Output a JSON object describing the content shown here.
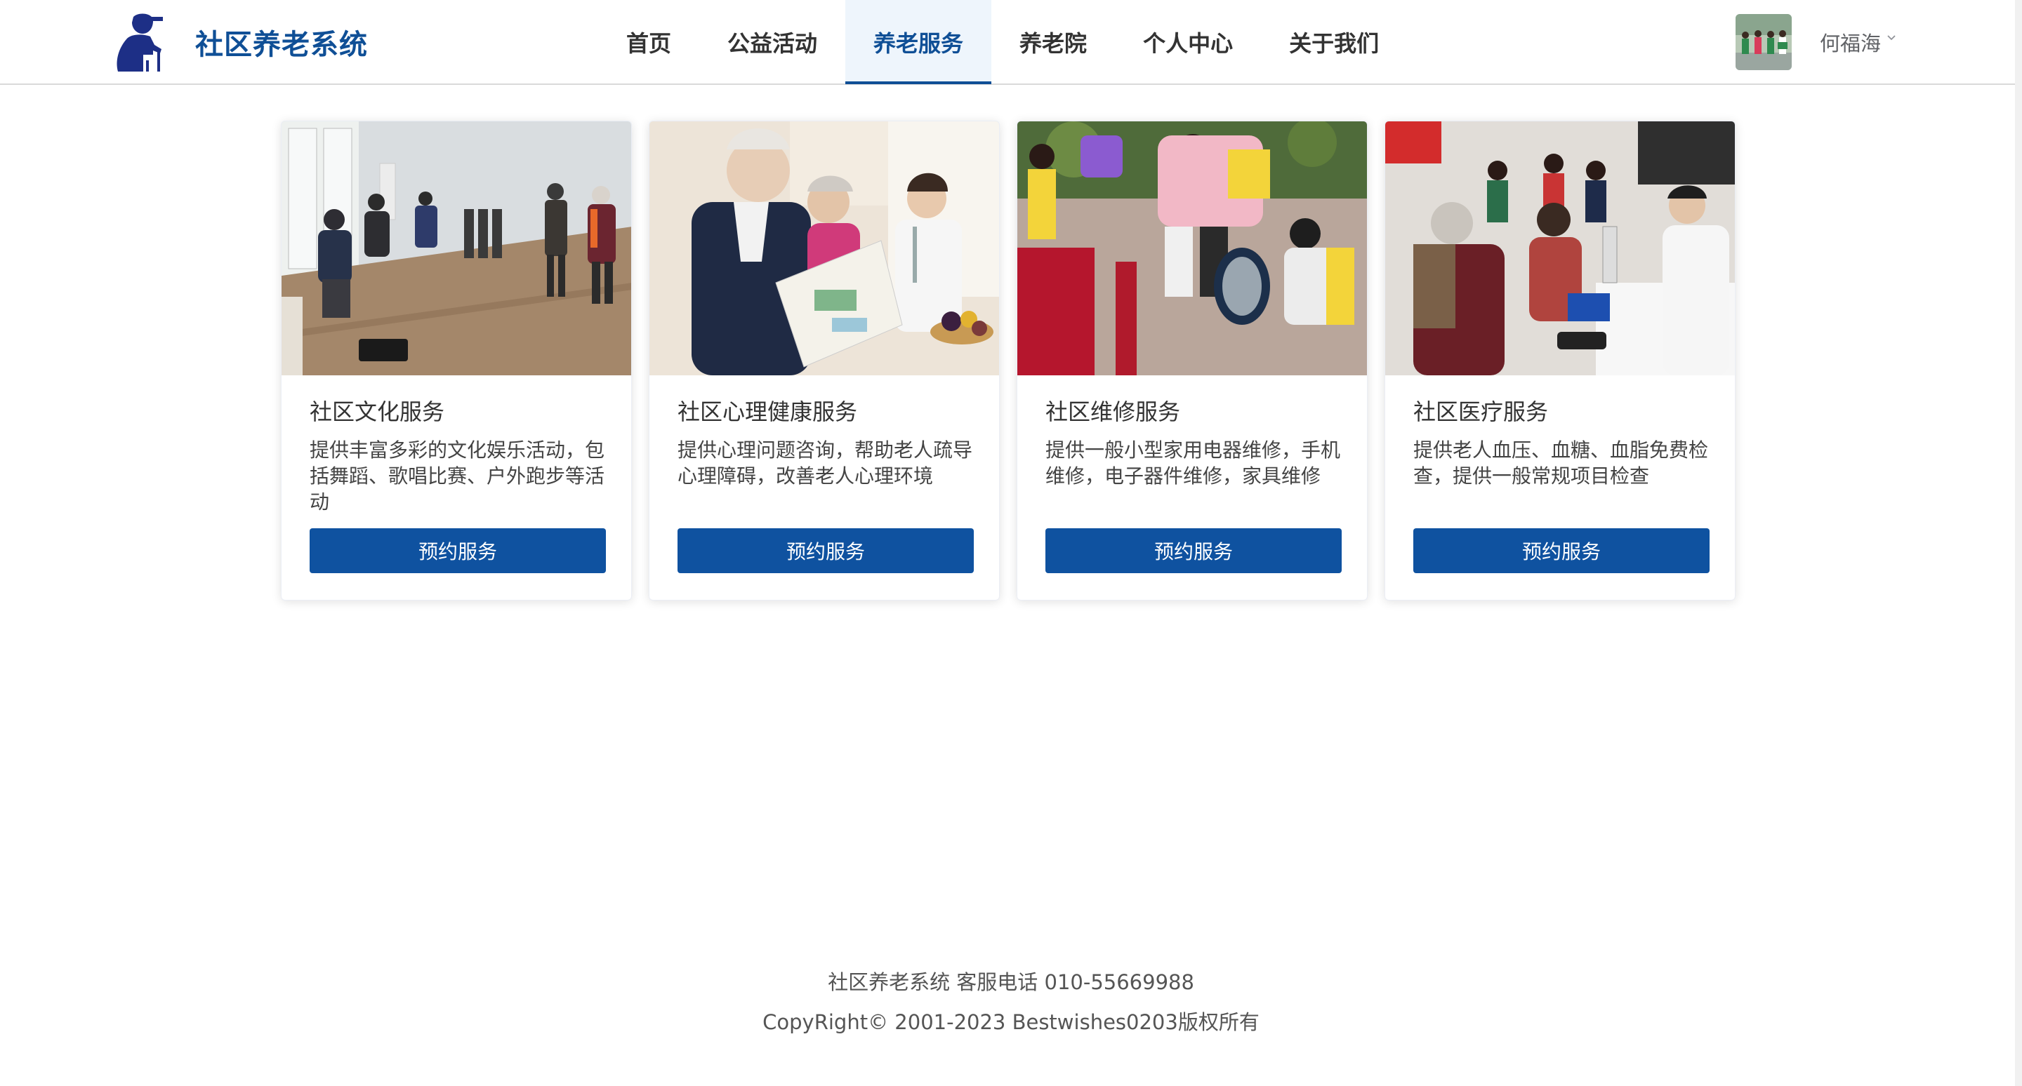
{
  "header": {
    "brand_title": "社区养老系统",
    "brand_color": "#0f4f96",
    "logo_icon": "elderly-person-icon",
    "nav": [
      {
        "label": "首页",
        "active": false
      },
      {
        "label": "公益活动",
        "active": false
      },
      {
        "label": "养老服务",
        "active": true
      },
      {
        "label": "养老院",
        "active": false
      },
      {
        "label": "个人中心",
        "active": false
      },
      {
        "label": "关于我们",
        "active": false
      }
    ],
    "user": {
      "name": "何福海",
      "avatar_icon": "user-avatar-photo",
      "dropdown_icon": "chevron-down-icon"
    }
  },
  "services": [
    {
      "title": "社区文化服务",
      "description": "提供丰富多彩的文化娱乐活动，包括舞蹈、歌唱比赛、户外跑步等活动",
      "button_label": "预约服务",
      "image_icon": "music-activity-photo"
    },
    {
      "title": "社区心理健康服务",
      "description": "提供心理问题咨询，帮助老人疏导心理障碍，改善老人心理环境",
      "button_label": "预约服务",
      "image_icon": "counseling-photo"
    },
    {
      "title": "社区维修服务",
      "description": "提供一般小型家用电器维修，手机维修，电子器件维修，家具维修",
      "button_label": "预约服务",
      "image_icon": "repair-photo"
    },
    {
      "title": "社区医疗服务",
      "description": "提供老人血压、血糖、血脂免费检查，提供一般常规项目检查",
      "button_label": "预约服务",
      "image_icon": "medical-checkup-photo"
    }
  ],
  "footer": {
    "line1": "社区养老系统 客服电话 010-55669988",
    "line2": "CopyRight© 2001-2023 Bestwishes0203版权所有"
  },
  "colors": {
    "button": "#0f52a0",
    "active_nav_bg": "#eef5fc"
  }
}
